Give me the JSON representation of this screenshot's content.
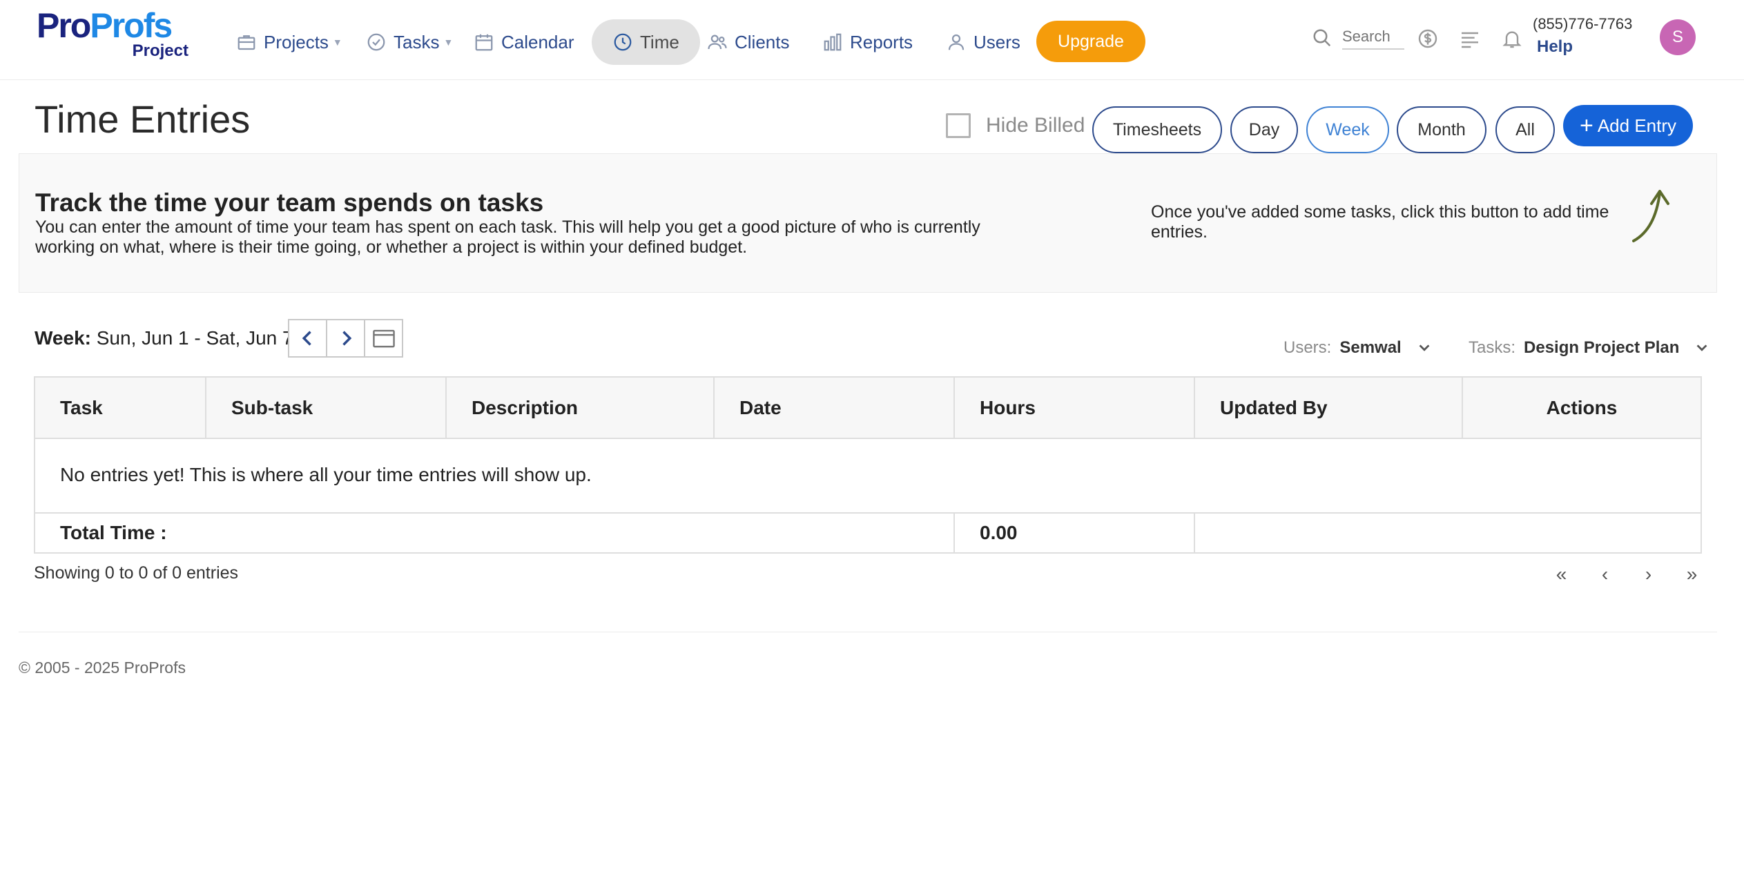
{
  "brand": {
    "logo_pro": "Pro",
    "logo_profs": "Profs",
    "logo_sub": "Project"
  },
  "nav": {
    "projects": "Projects",
    "tasks": "Tasks",
    "calendar": "Calendar",
    "time": "Time",
    "clients": "Clients",
    "reports": "Reports",
    "users": "Users",
    "upgrade": "Upgrade"
  },
  "topbar": {
    "search_placeholder": "Search",
    "phone": "(855)776-7763",
    "help": "Help",
    "avatar_initial": "S"
  },
  "header": {
    "title": "Time Entries",
    "hide_billed": "Hide Billed",
    "views": [
      "Timesheets",
      "Day",
      "Week",
      "Month",
      "All"
    ],
    "active_view": "Week",
    "add_entry": "Add Entry"
  },
  "banner": {
    "title": "Track the time your team spends on tasks",
    "text": "You can enter the amount of time your team has spent on each task. This will help you get a good picture of who is currently working on what, where is their time going, or whether a project is within your defined budget.",
    "hint": "Once you've added some tasks, click this button to add time entries."
  },
  "week": {
    "label": "Week:",
    "range": "Sun, Jun 1 - Sat, Jun 7"
  },
  "filters": {
    "users_label": "Users:",
    "users_value": "Semwal",
    "tasks_label": "Tasks:",
    "tasks_value": "Design Project Plan"
  },
  "table": {
    "columns": [
      "Task",
      "Sub-task",
      "Description",
      "Date",
      "Hours",
      "Updated By",
      "Actions"
    ],
    "empty_message": "No entries yet! This is where all your time entries will show up.",
    "total_label": "Total Time :",
    "total_value": "0.00"
  },
  "pagination": {
    "showing": "Showing 0 to 0 of 0 entries",
    "first": "«",
    "prev": "‹",
    "next": "›",
    "last": "»"
  },
  "footer": {
    "copyright": "© 2005 - 2025 ProProfs"
  },
  "colors": {
    "primary": "#1563d8",
    "upgrade": "#f59c0b",
    "nav_text": "#2c4a8c",
    "avatar": "#c866b4"
  }
}
